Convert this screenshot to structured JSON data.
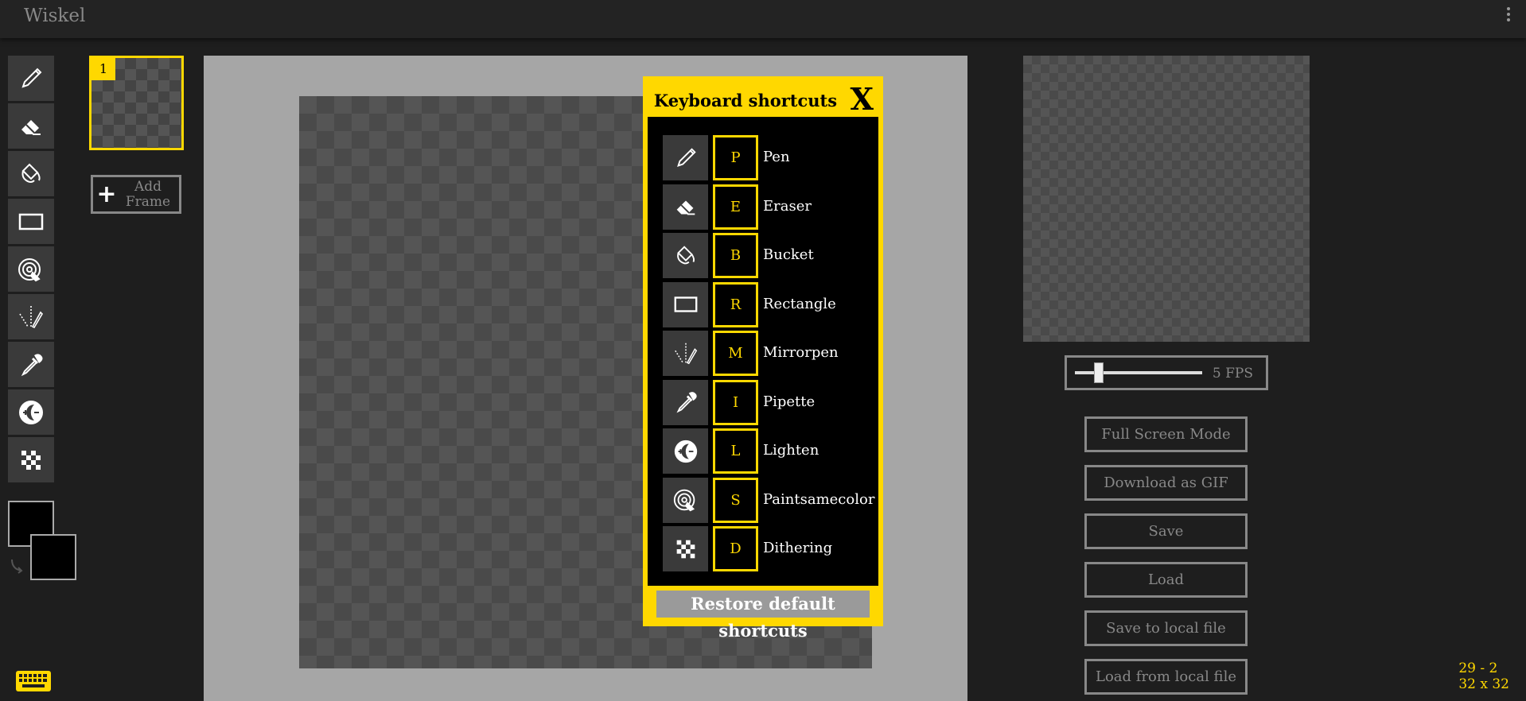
{
  "app": {
    "title": "Wiskel"
  },
  "tools": [
    {
      "name": "pen",
      "icon": "pen-icon"
    },
    {
      "name": "eraser",
      "icon": "eraser-icon"
    },
    {
      "name": "bucket",
      "icon": "bucket-icon"
    },
    {
      "name": "rectangle",
      "icon": "rectangle-icon"
    },
    {
      "name": "paintsamecolor",
      "icon": "paintsamecolor-icon"
    },
    {
      "name": "mirrorpen",
      "icon": "mirrorpen-icon"
    },
    {
      "name": "pipette",
      "icon": "pipette-icon"
    },
    {
      "name": "lighten",
      "icon": "lighten-icon"
    },
    {
      "name": "dithering",
      "icon": "dithering-icon"
    }
  ],
  "colors": {
    "primary": "#000000",
    "secondary": "#000000",
    "accent": "#ffd800"
  },
  "frames": {
    "items": [
      {
        "number": "1"
      }
    ],
    "add_label": "Add Frame"
  },
  "shortcuts": {
    "title": "Keyboard shortcuts",
    "close": "X",
    "items": [
      {
        "key": "P",
        "label": "Pen",
        "icon": "pen-icon"
      },
      {
        "key": "E",
        "label": "Eraser",
        "icon": "eraser-icon"
      },
      {
        "key": "B",
        "label": "Bucket",
        "icon": "bucket-icon"
      },
      {
        "key": "R",
        "label": "Rectangle",
        "icon": "rectangle-icon"
      },
      {
        "key": "M",
        "label": "Mirrorpen",
        "icon": "mirrorpen-icon"
      },
      {
        "key": "I",
        "label": "Pipette",
        "icon": "pipette-icon"
      },
      {
        "key": "L",
        "label": "Lighten",
        "icon": "lighten-icon"
      },
      {
        "key": "S",
        "label": "Paintsamecolor",
        "icon": "paintsamecolor-icon"
      },
      {
        "key": "D",
        "label": "Dithering",
        "icon": "dithering-icon"
      }
    ],
    "restore": "Restore default shortcuts"
  },
  "preview": {
    "fps_label": "5 FPS",
    "fps_value": 5,
    "buttons": [
      "Full Screen Mode",
      "Download as GIF",
      "Save",
      "Load",
      "Save to local file",
      "Load from local file"
    ]
  },
  "status": {
    "cursor": "29 - 2",
    "size": "32 x 32"
  }
}
